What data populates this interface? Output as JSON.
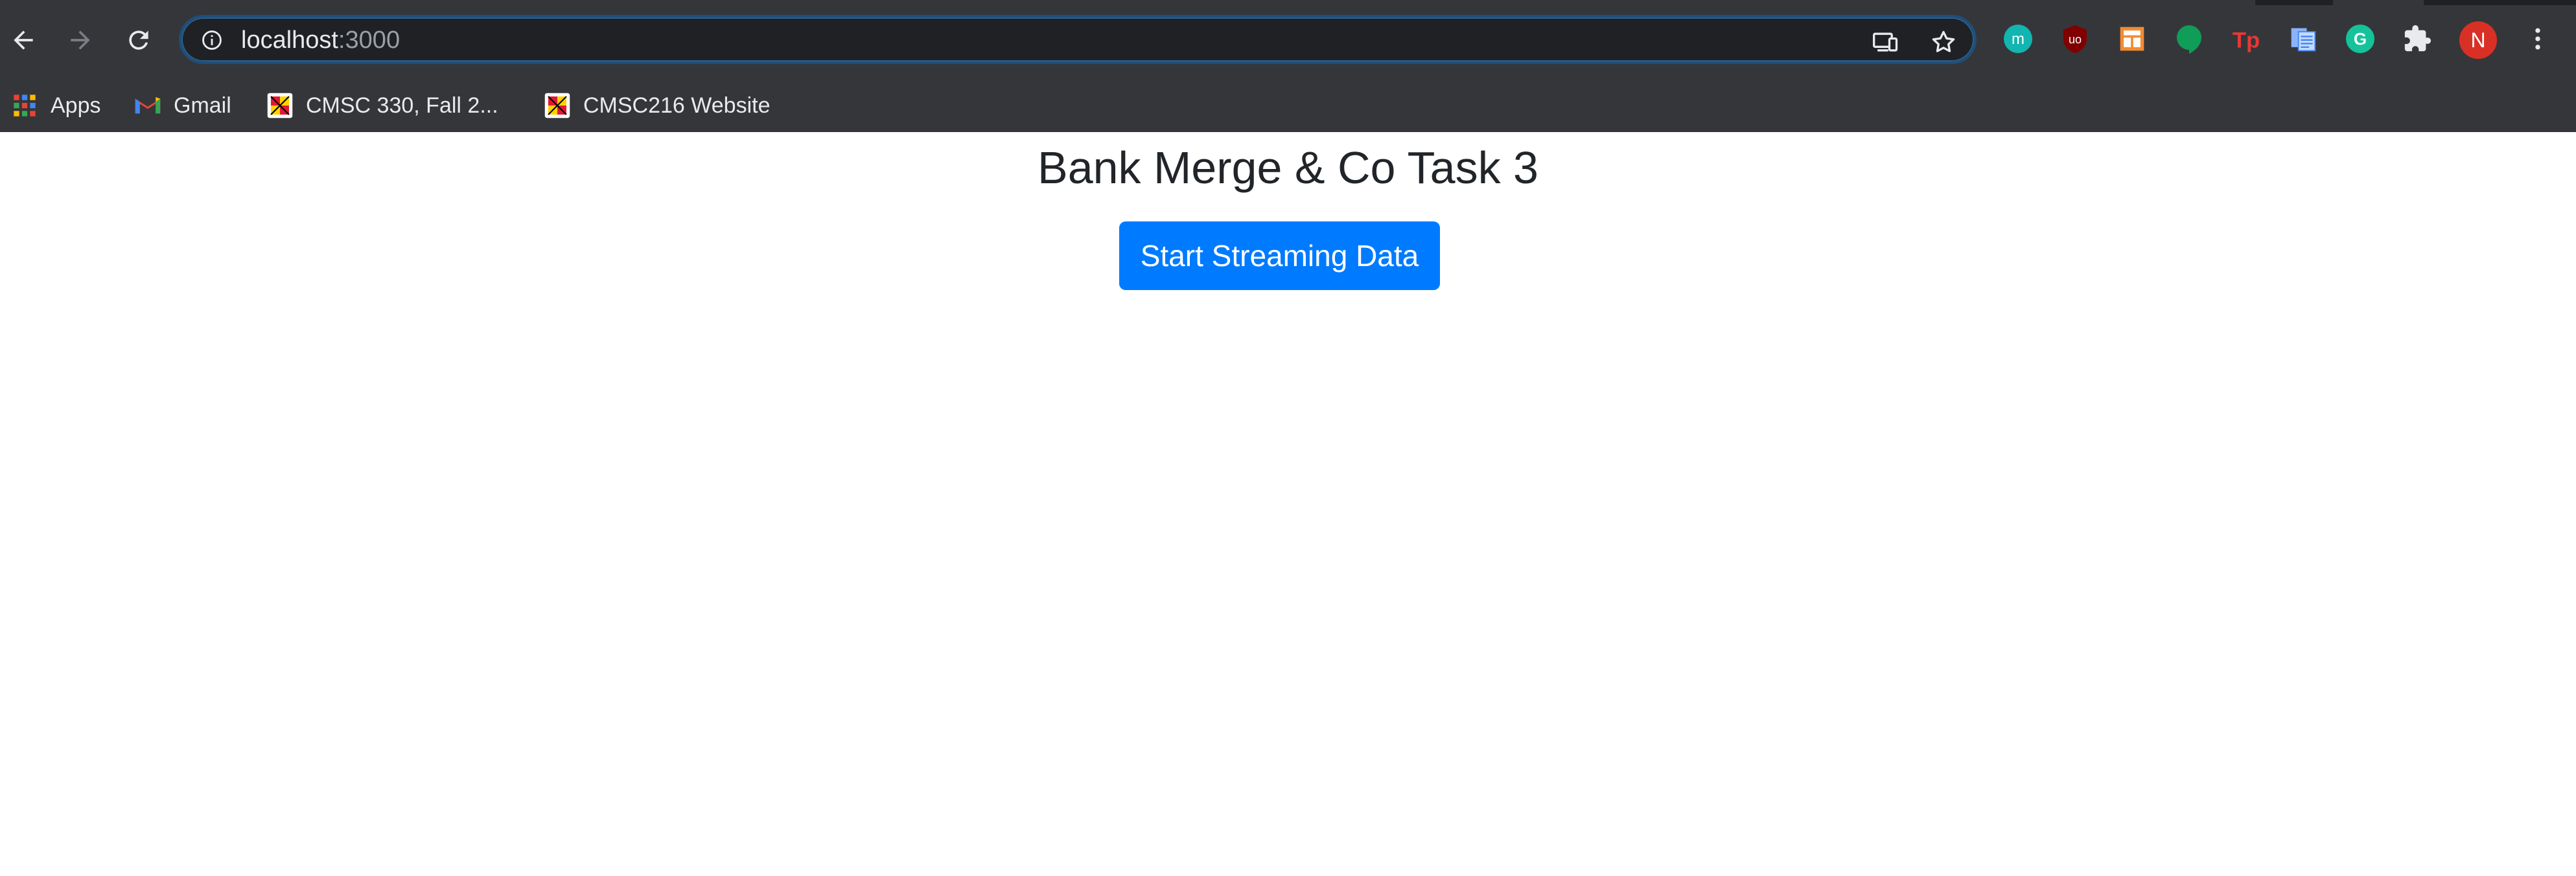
{
  "browser": {
    "url_host": "localhost",
    "url_port": ":3000",
    "profile_initial": "N",
    "bookmarks": [
      {
        "label": "Apps",
        "icon": "apps-grid-icon"
      },
      {
        "label": "Gmail",
        "icon": "gmail-icon"
      },
      {
        "label": "CMSC 330, Fall 2...",
        "icon": "umd-crest-icon"
      },
      {
        "label": "CMSC216 Website",
        "icon": "umd-crest-icon"
      }
    ],
    "extensions": [
      {
        "name": "m-extension-icon",
        "color": "#12b5b0",
        "glyph": "m"
      },
      {
        "name": "ublock-icon",
        "color": "#800000",
        "glyph": "uo"
      },
      {
        "name": "layout-extension-icon",
        "color": "#f28b33",
        "glyph": ""
      },
      {
        "name": "hangouts-icon",
        "color": "#0f9d58",
        "glyph": ""
      },
      {
        "name": "tp-extension-icon",
        "color": "#e53935",
        "glyph": "Tp"
      },
      {
        "name": "docs-extension-icon",
        "color": "#8ab4f8",
        "glyph": ""
      },
      {
        "name": "grammarly-icon",
        "color": "#15c39a",
        "glyph": "G"
      },
      {
        "name": "extensions-puzzle-icon",
        "color": "#e8eaed",
        "glyph": ""
      }
    ]
  },
  "page": {
    "title": "Bank Merge & Co Task 3",
    "button_label": "Start Streaming Data"
  },
  "colors": {
    "chrome_bg": "#35363a",
    "omnibox_bg": "#202124",
    "primary": "#007bff"
  }
}
